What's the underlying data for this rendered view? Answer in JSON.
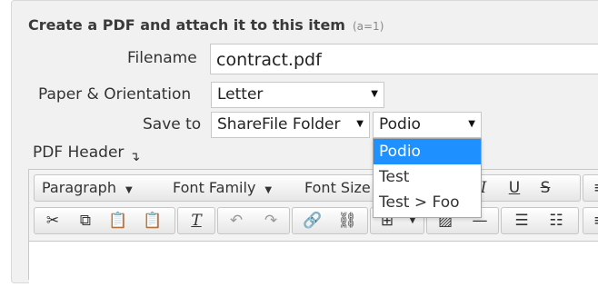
{
  "title": "Create a PDF and attach it to this item",
  "title_hint": "(a=1)",
  "filename": {
    "label": "Filename",
    "value": "contract.pdf"
  },
  "paper": {
    "label": "Paper & Orientation",
    "value": "Letter"
  },
  "save_to": {
    "label": "Save to",
    "folder_value": "ShareFile Folder",
    "target_value": "Podio"
  },
  "dropdown_options": [
    "Podio",
    "Test",
    "Test > Foo"
  ],
  "pdf_header_label": "PDF Header",
  "toolbar": {
    "format": "Paragraph",
    "font_family": "Font Family",
    "font_size": "Font Size"
  },
  "colors": {
    "selected": "#1e90ff",
    "panel": "#f1f1f1"
  }
}
